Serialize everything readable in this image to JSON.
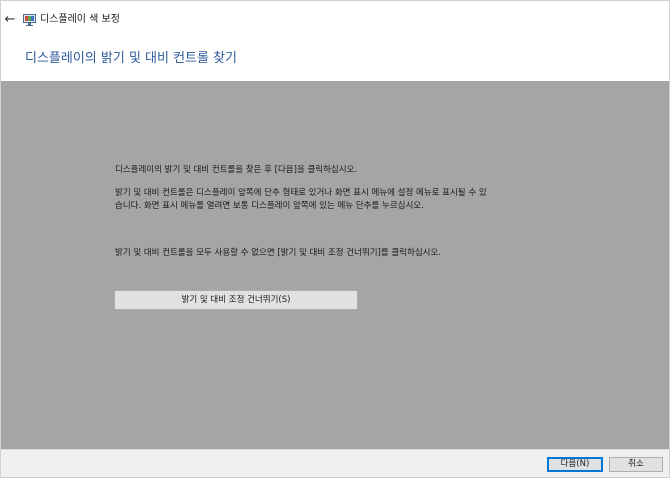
{
  "window": {
    "title": "디스플레이 색 보정",
    "back_glyph": "←"
  },
  "page": {
    "heading": "디스플레이의 밝기 및 대비 컨트롤 찾기"
  },
  "instructions": {
    "line1": "디스플레이의 밝기 및 대비 컨트롤을 찾은 후 [다음]을 클릭하십시오.",
    "line2": "밝기 및 대비 컨트롤은 디스플레이 앞쪽에 단추 형태로 있거나 화면 표시 메뉴에 설정 메뉴로 표시될 수 있",
    "line3": "습니다. 화면 표시 메뉴를 열려면 보통 디스플레이 앞쪽에 있는 메뉴 단추를 누르십시오.",
    "line4": "밝기 및 대비 컨트롤을 모두 사용할 수 없으면 [밝기 및 대비 조정 건너뛰기]를 클릭하십시오."
  },
  "buttons": {
    "skip_label": "밝기 및 대비 조정 건너뛰기(S)",
    "next_label": "다음(N)",
    "cancel_label": "취소"
  },
  "colors": {
    "heading": "#2d5a9a",
    "content_bg": "#a5a5a5",
    "footer_bg": "#f0f0f0",
    "default_button_border": "#0078d7"
  }
}
